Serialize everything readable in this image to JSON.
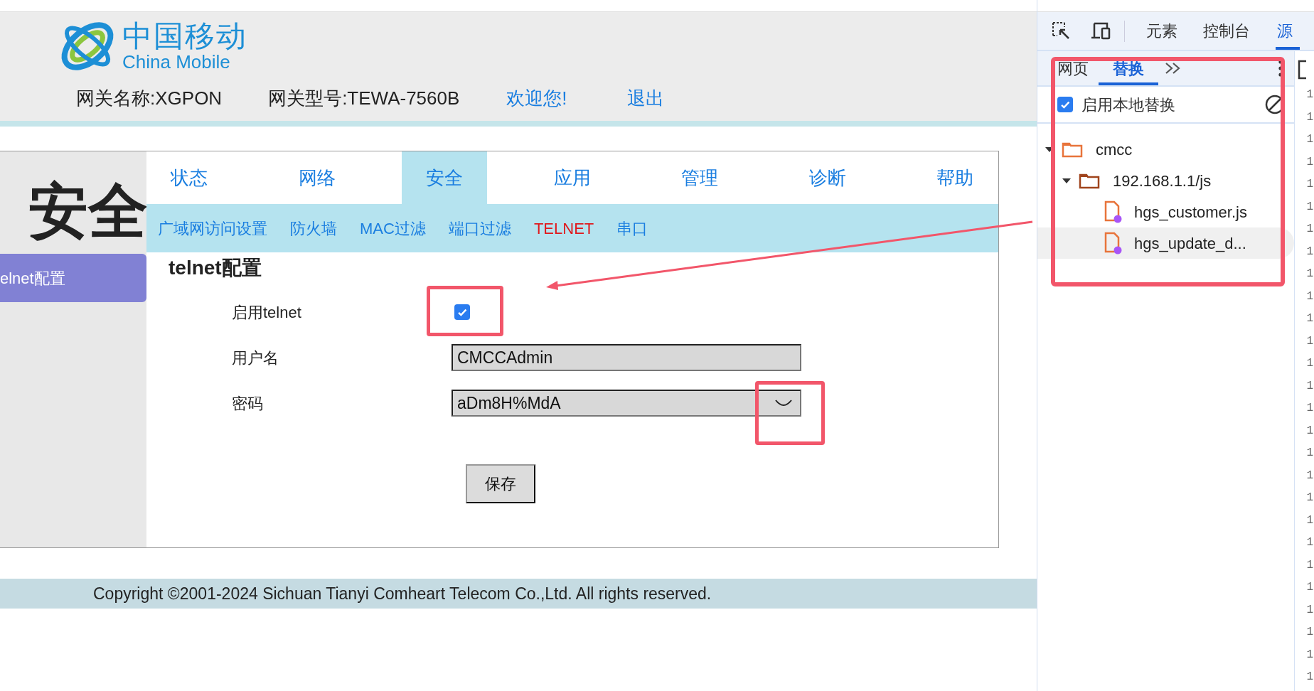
{
  "header": {
    "logo_cn": "中国移动",
    "logo_en": "China Mobile",
    "gateway_name": "网关名称:XGPON",
    "gateway_model": "网关型号:TEWA-7560B",
    "welcome": "欢迎您!",
    "logout": "退出"
  },
  "section_title": "安全",
  "sidebar": {
    "items": [
      {
        "label": "elnet配置",
        "selected": true
      }
    ]
  },
  "nav": {
    "tabs": [
      {
        "label": "状态",
        "selected": false
      },
      {
        "label": "网络",
        "selected": false
      },
      {
        "label": "安全",
        "selected": true
      },
      {
        "label": "应用",
        "selected": false
      },
      {
        "label": "管理",
        "selected": false
      },
      {
        "label": "诊断",
        "selected": false
      },
      {
        "label": "帮助",
        "selected": false
      }
    ]
  },
  "subnav": {
    "items": [
      {
        "label": "广域网访问设置",
        "selected": false
      },
      {
        "label": "防火墙",
        "selected": false
      },
      {
        "label": "MAC过滤",
        "selected": false
      },
      {
        "label": "端口过滤",
        "selected": false
      },
      {
        "label": "TELNET",
        "selected": true
      },
      {
        "label": "串口",
        "selected": false
      }
    ]
  },
  "form": {
    "title": "telnet配置",
    "enable": {
      "label": "启用telnet",
      "checked": true
    },
    "username": {
      "label": "用户名",
      "value": "CMCCAdmin"
    },
    "password": {
      "label": "密码",
      "value": "aDm8H%MdA"
    },
    "save": "保存"
  },
  "footer": "Copyright ©2001-2024 Sichuan Tianyi Comheart Telecom Co.,Ltd. All rights reserved.",
  "devtools": {
    "tabs": [
      {
        "label": "元素",
        "selected": false
      },
      {
        "label": "控制台",
        "selected": false
      },
      {
        "label": "源",
        "selected": true
      }
    ],
    "sources_tabs": [
      {
        "label": "网页",
        "selected": false
      },
      {
        "label": "替换",
        "selected": true
      }
    ],
    "enable_overrides": {
      "label": "启用本地替换",
      "checked": true
    },
    "tree": [
      {
        "label": "cmcc",
        "kind": "folder",
        "expanded": true,
        "children": [
          {
            "label": "192.168.1.1/js",
            "kind": "folder",
            "expanded": true,
            "children": [
              {
                "label": "hgs_customer.js",
                "kind": "file",
                "selected": false
              },
              {
                "label": "hgs_update_d...",
                "kind": "file",
                "selected": true
              }
            ]
          }
        ]
      }
    ],
    "line_numbers": [
      "1",
      "1",
      "1",
      "1",
      "1",
      "1",
      "1",
      "1",
      "1",
      "1",
      "1",
      "1",
      "1",
      "1",
      "1",
      "1",
      "1",
      "1",
      "1",
      "1",
      "1",
      "1",
      "1",
      "1",
      "1",
      "1",
      "1"
    ]
  }
}
